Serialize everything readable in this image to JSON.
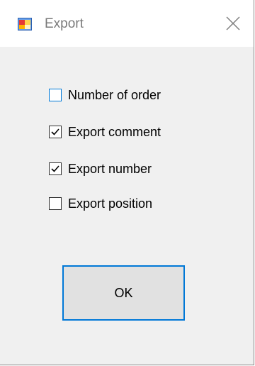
{
  "window": {
    "title": "Export",
    "app_icon": "application-icon",
    "close_icon": "close-icon"
  },
  "options": [
    {
      "label": "Number of order",
      "checked": false,
      "focused": true
    },
    {
      "label": "Export comment",
      "checked": true,
      "focused": false
    },
    {
      "label": "Export number",
      "checked": true,
      "focused": false
    },
    {
      "label": "Export position",
      "checked": false,
      "focused": false
    }
  ],
  "ok_button": {
    "label": "OK"
  },
  "colors": {
    "accent": "#0078d7",
    "background": "#f0f0f0",
    "titlebar": "#ffffff"
  }
}
